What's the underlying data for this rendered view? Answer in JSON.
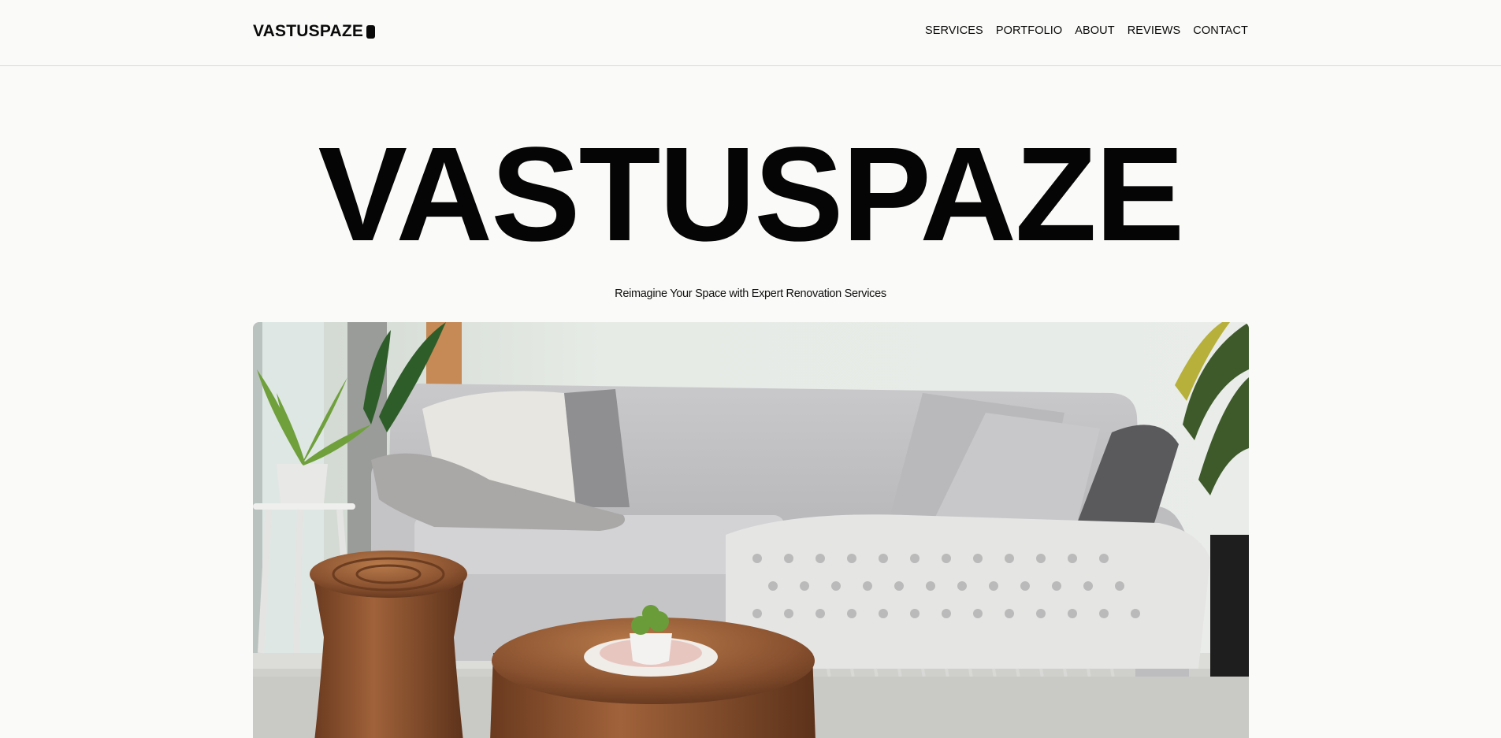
{
  "brand": {
    "logo_text": "VASTUSPAZE",
    "logo_icon": "rounded-block-icon"
  },
  "nav": {
    "items": [
      {
        "label": "SERVICES"
      },
      {
        "label": "PORTFOLIO"
      },
      {
        "label": "ABOUT"
      },
      {
        "label": "REVIEWS"
      },
      {
        "label": "CONTACT"
      }
    ]
  },
  "hero": {
    "title": "VASTUSPAZE",
    "subtitle": "Reimagine Your Space with Expert Renovation Services",
    "image_subject": "living-room-photo"
  },
  "colors": {
    "background": "#fafaf8",
    "text": "#0a0a0a",
    "divider": "#d9d9d6"
  }
}
